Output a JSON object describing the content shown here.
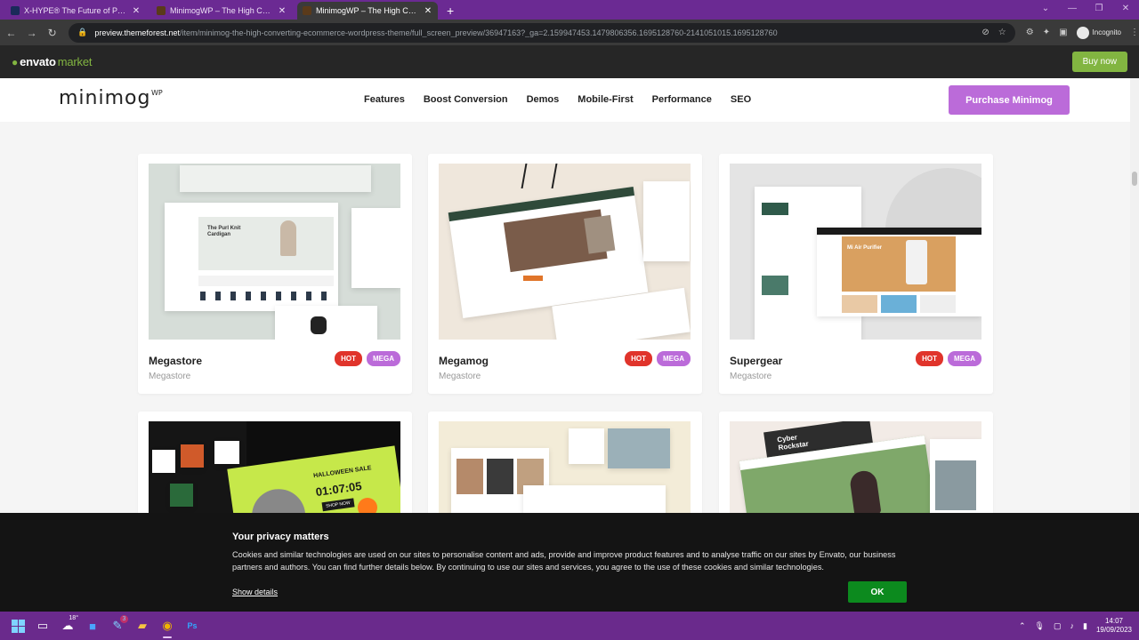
{
  "browser": {
    "tabs": [
      {
        "title": "X-HYPE® The Future of Performa",
        "active": false,
        "favicon_color": "#1a2a5a"
      },
      {
        "title": "MinimogWP – The High Convert",
        "active": false,
        "favicon_color": "#5a3a1a"
      },
      {
        "title": "MinimogWP – The High Convert",
        "active": true,
        "favicon_color": "#5a3a1a"
      }
    ],
    "url_host": "preview.themeforest.net",
    "url_path": "/item/minimog-the-high-converting-ecommerce-wordpress-theme/full_screen_preview/36947163?_ga=2.159947453.1479806356.1695128760-2141051015.1695128760",
    "profile_label": "Incognito"
  },
  "envato": {
    "logo_text": "envato",
    "logo_suffix": "market",
    "buy_now": "Buy now",
    "accent": "#82b541"
  },
  "site": {
    "brand": "minimog",
    "brand_sup": "WP",
    "nav": [
      "Features",
      "Boost Conversion",
      "Demos",
      "Mobile-First",
      "Performance",
      "SEO"
    ],
    "purchase_label": "Purchase Minimog",
    "accent": "#bb6bd9"
  },
  "cards": [
    {
      "name": "Megastore",
      "sub": "Megastore",
      "badges": [
        "HOT",
        "MEGA"
      ]
    },
    {
      "name": "Megamog",
      "sub": "Megastore",
      "badges": [
        "HOT",
        "MEGA"
      ]
    },
    {
      "name": "Supergear",
      "sub": "Megastore",
      "badges": [
        "HOT",
        "MEGA"
      ]
    },
    {
      "name": "",
      "sub": "",
      "badges": []
    },
    {
      "name": "",
      "sub": "",
      "badges": []
    },
    {
      "name": "",
      "sub": "",
      "badges": []
    }
  ],
  "thumb_text": {
    "megastore_hero": "The Purl Knit Cardigan",
    "halloween": "HALLOWEEN SALE",
    "countdown": "01:07:05",
    "shop_now": "SHOP NOW",
    "supergear_hero": "Mi Air Purifier",
    "cyber": "Cyber Rockstar"
  },
  "cookie": {
    "title": "Your privacy matters",
    "text": "Cookies and similar technologies are used on our sites to personalise content and ads, provide and improve product features and to analyse traffic on our sites by Envato, our business partners and authors. You can find further details below. By continuing to use our sites and services, you agree to the use of these cookies and similar technologies.",
    "show_details": "Show details",
    "ok": "OK"
  },
  "taskbar": {
    "weather": "18°",
    "badge_count": "3",
    "time": "14:07",
    "date": "19/09/2023"
  }
}
